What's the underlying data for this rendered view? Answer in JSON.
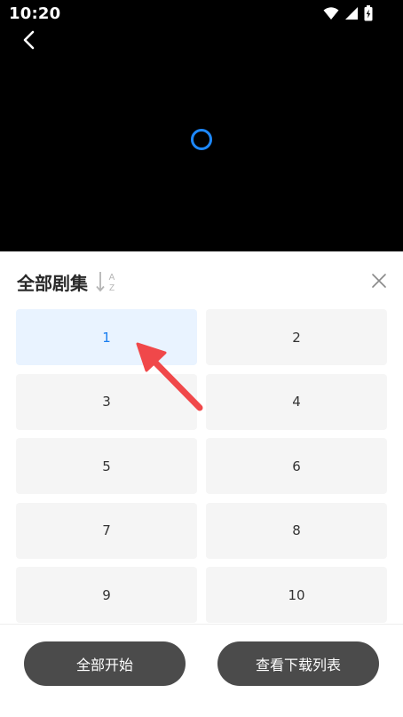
{
  "status_bar": {
    "time": "10:20"
  },
  "sheet": {
    "title": "全部剧集",
    "sort_label": "AZ",
    "episodes": [
      "1",
      "2",
      "3",
      "4",
      "5",
      "6",
      "7",
      "8",
      "9",
      "10"
    ],
    "selected_index": 0
  },
  "bottom": {
    "start_all": "全部开始",
    "view_downloads": "查看下载列表"
  },
  "colors": {
    "accent": "#1a7ef0",
    "active_tile_bg": "#e9f3ff",
    "button_bg": "#4b4b4b",
    "annotation_arrow": "#f0484a"
  }
}
